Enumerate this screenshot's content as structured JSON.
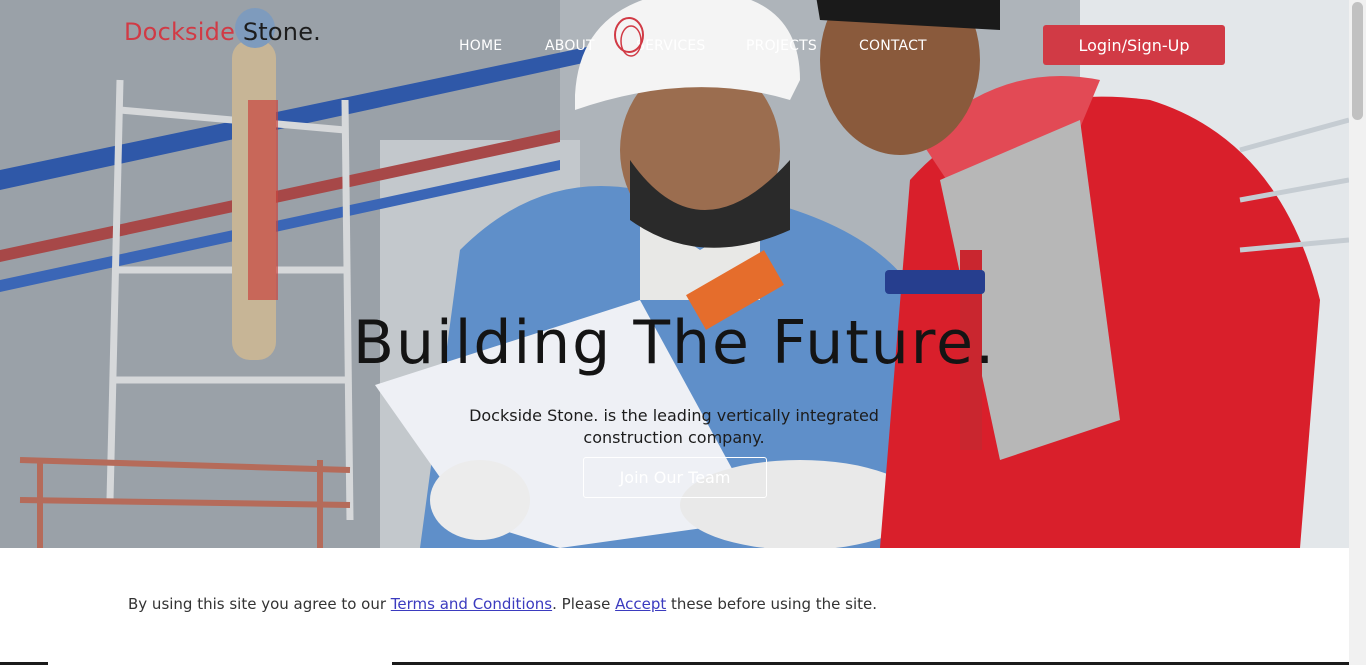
{
  "brand": {
    "part1": "Dockside",
    "part2": " Stone."
  },
  "nav": {
    "home": "HOME",
    "about": "ABOUT",
    "services": "SERVICES",
    "projects": "PROJECTS",
    "contact": "CONTACT"
  },
  "login_button": "Login/Sign-Up",
  "hero": {
    "title": "Building The Future.",
    "subtitle": "Dockside Stone. is the leading vertically integrated construction company.",
    "cta": "Join Our Team"
  },
  "consent": {
    "before": "By using this site you agree to our ",
    "terms_link": "Terms and Conditions",
    "middle": ". Please ",
    "accept_link": "Accept",
    "after": " these before using the site."
  },
  "colors": {
    "accent": "#d13a45",
    "link": "#3b3bbf"
  }
}
